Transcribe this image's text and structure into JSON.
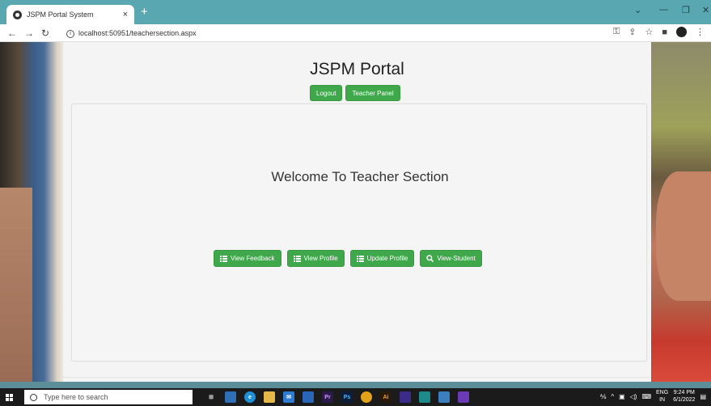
{
  "browser": {
    "tab_title": "JSPM Portal System",
    "tab_close": "×",
    "new_tab": "+",
    "url": "localhost:50951/teachersection.aspx",
    "controls": {
      "minimize": "—",
      "maximize": "❐",
      "close": "✕",
      "dropdown": "⌄"
    }
  },
  "page": {
    "title": "JSPM Portal",
    "top_buttons": [
      "Logout",
      "Teacher Panel"
    ],
    "welcome": "Welcome To Teacher Section",
    "actions": [
      {
        "label": "View Feedback",
        "icon": "list-icon"
      },
      {
        "label": "View Profile",
        "icon": "list-icon"
      },
      {
        "label": "Update Profile",
        "icon": "list-icon"
      },
      {
        "label": "View-Student",
        "icon": "search-icon"
      }
    ]
  },
  "taskbar": {
    "search_placeholder": "Type here to search",
    "lang_top": "ENG",
    "lang_bottom": "IN",
    "time": "9:24 PM",
    "date": "6/1/2022"
  },
  "colors": {
    "accent": "#3fa84b",
    "tabbar": "#59a7b1"
  }
}
